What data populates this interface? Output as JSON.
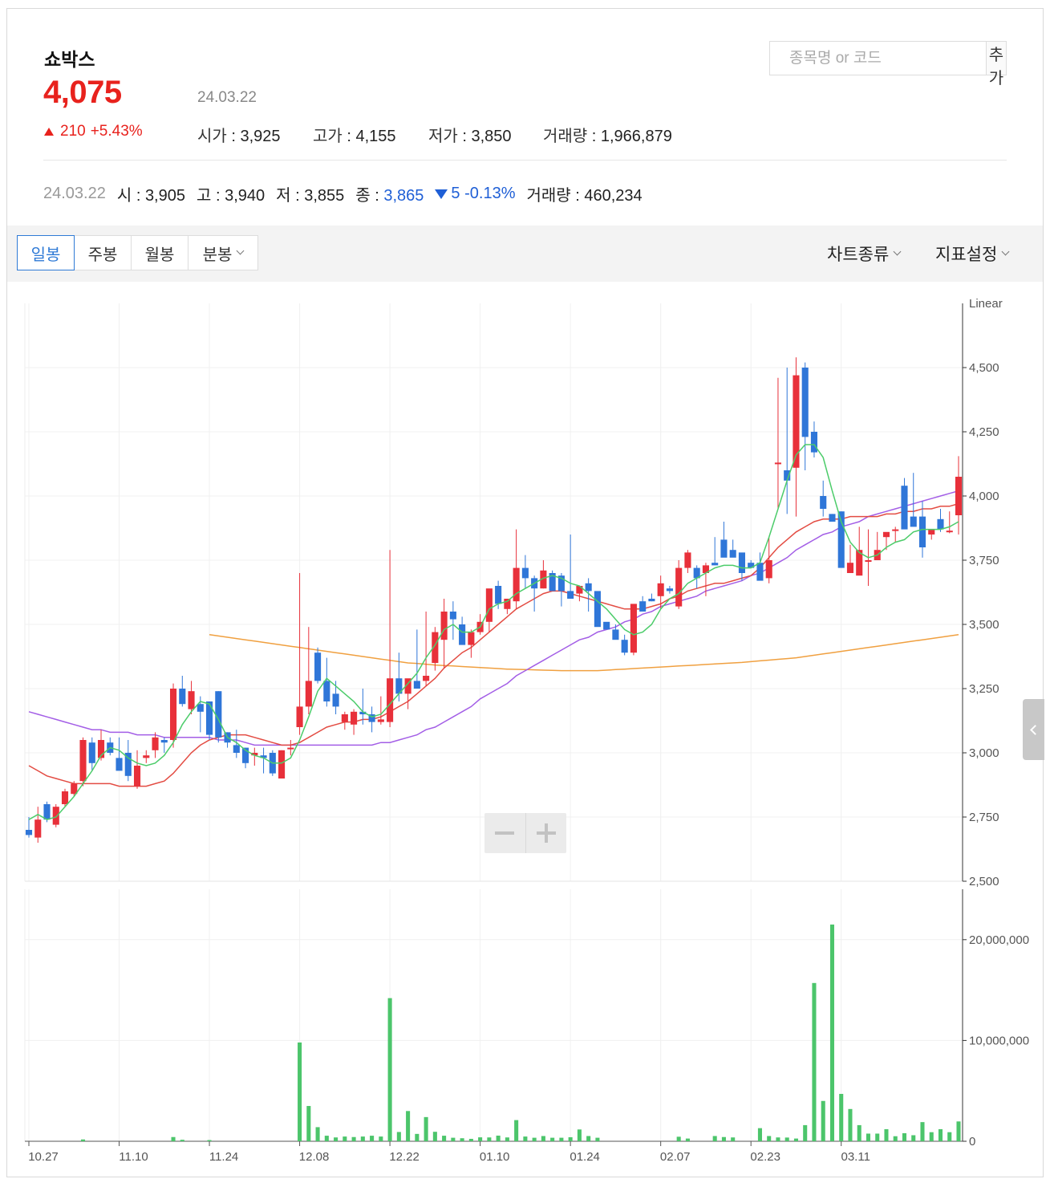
{
  "stock": {
    "name": "쇼박스",
    "price": "4,075",
    "date": "24.03.22",
    "change": "210",
    "change_pct": "+5.43%",
    "open_label": "시가",
    "open": "3,925",
    "high_label": "고가",
    "high": "4,155",
    "low_label": "저가",
    "low": "3,850",
    "volume_label": "거래량",
    "volume": "1,966,879"
  },
  "search": {
    "placeholder": "종목명 or 코드",
    "button": "추가"
  },
  "crosshair": {
    "date": "24.03.22",
    "open_label": "시",
    "open": "3,905",
    "high_label": "고",
    "high": "3,940",
    "low_label": "저",
    "low": "3,855",
    "close_label": "종",
    "close": "3,865",
    "change": "5",
    "change_pct": "-0.13%",
    "volume_label": "거래량",
    "volume": "460,234"
  },
  "tabs": [
    {
      "label": "일봉",
      "active": true
    },
    {
      "label": "주봉",
      "active": false
    },
    {
      "label": "월봉",
      "active": false
    },
    {
      "label": "분봉",
      "active": false
    }
  ],
  "toolbar": {
    "chart_type": "차트종류",
    "indicator": "지표설정"
  },
  "colors": {
    "up": "#e8303a",
    "down": "#2f76d8",
    "ma5": "#4ccc6a",
    "ma20": "#e34c43",
    "ma60": "#a35ee6",
    "ma120": "#f0a040",
    "volume": "#4cc56b"
  },
  "chart_data": [
    {
      "type": "candlestick",
      "scale_label": "Linear",
      "ylim": [
        2500,
        4750
      ],
      "y_ticks": [
        "2,500",
        "2,750",
        "3,000",
        "3,250",
        "3,500",
        "3,750",
        "4,000",
        "4,250",
        "4,500"
      ],
      "x_ticks": [
        {
          "label": "10.27",
          "index": 0
        },
        {
          "label": "11.10",
          "index": 10
        },
        {
          "label": "11.24",
          "index": 20
        },
        {
          "label": "12.08",
          "index": 30
        },
        {
          "label": "12.22",
          "index": 40
        },
        {
          "label": "01.10",
          "index": 50
        },
        {
          "label": "01.24",
          "index": 60
        },
        {
          "label": "02.07",
          "index": 70
        },
        {
          "label": "02.23",
          "index": 80
        },
        {
          "label": "03.11",
          "index": 90
        }
      ],
      "ohlc": [
        [
          2700,
          2750,
          2670,
          2680
        ],
        [
          2670,
          2790,
          2650,
          2740
        ],
        [
          2800,
          2810,
          2730,
          2740
        ],
        [
          2720,
          2800,
          2710,
          2790
        ],
        [
          2800,
          2860,
          2790,
          2850
        ],
        [
          2840,
          2890,
          2830,
          2880
        ],
        [
          2890,
          3060,
          2870,
          3050
        ],
        [
          3040,
          3060,
          2930,
          2960
        ],
        [
          2980,
          3090,
          2970,
          3050
        ],
        [
          3040,
          3060,
          2990,
          3000
        ],
        [
          2980,
          3060,
          2950,
          2930
        ],
        [
          3000,
          3050,
          2890,
          2910
        ],
        [
          2870,
          3010,
          2860,
          2950
        ],
        [
          2980,
          3010,
          2960,
          2990
        ],
        [
          3010,
          3080,
          2980,
          3060
        ],
        [
          3050,
          3060,
          3000,
          3040
        ],
        [
          3050,
          3270,
          3020,
          3250
        ],
        [
          3250,
          3300,
          3180,
          3190
        ],
        [
          3170,
          3280,
          3150,
          3240
        ],
        [
          3190,
          3220,
          3080,
          3160
        ],
        [
          3200,
          3200,
          3050,
          3070
        ],
        [
          3240,
          3240,
          3040,
          3060
        ],
        [
          3080,
          3080,
          3020,
          3040
        ],
        [
          3030,
          3090,
          2980,
          3000
        ],
        [
          3020,
          3020,
          2940,
          2960
        ],
        [
          2990,
          3020,
          2950,
          3000
        ],
        [
          2990,
          3020,
          2920,
          2980
        ],
        [
          3000,
          3010,
          2910,
          2920
        ],
        [
          2900,
          3010,
          2900,
          3010
        ],
        [
          3020,
          3050,
          2990,
          3020
        ],
        [
          3100,
          3700,
          3070,
          3180
        ],
        [
          3180,
          3490,
          3150,
          3280
        ],
        [
          3390,
          3410,
          3270,
          3280
        ],
        [
          3280,
          3370,
          3180,
          3200
        ],
        [
          3230,
          3280,
          3150,
          3180
        ],
        [
          3120,
          3160,
          3090,
          3150
        ],
        [
          3110,
          3170,
          3070,
          3160
        ],
        [
          3160,
          3250,
          3110,
          3150
        ],
        [
          3150,
          3180,
          3080,
          3120
        ],
        [
          3120,
          3220,
          3110,
          3130
        ],
        [
          3120,
          3790,
          3100,
          3290
        ],
        [
          3290,
          3390,
          3200,
          3230
        ],
        [
          3230,
          3270,
          3170,
          3290
        ],
        [
          3280,
          3480,
          3280,
          3250
        ],
        [
          3280,
          3550,
          3260,
          3300
        ],
        [
          3350,
          3490,
          3320,
          3470
        ],
        [
          3440,
          3600,
          3330,
          3550
        ],
        [
          3550,
          3590,
          3440,
          3520
        ],
        [
          3500,
          3530,
          3450,
          3420
        ],
        [
          3420,
          3480,
          3370,
          3470
        ],
        [
          3470,
          3540,
          3460,
          3510
        ],
        [
          3510,
          3560,
          3470,
          3640
        ],
        [
          3650,
          3670,
          3560,
          3580
        ],
        [
          3560,
          3580,
          3540,
          3600
        ],
        [
          3590,
          3870,
          3560,
          3720
        ],
        [
          3720,
          3770,
          3640,
          3680
        ],
        [
          3680,
          3690,
          3550,
          3640
        ],
        [
          3640,
          3750,
          3640,
          3710
        ],
        [
          3700,
          3710,
          3640,
          3630
        ],
        [
          3690,
          3700,
          3570,
          3630
        ],
        [
          3630,
          3850,
          3620,
          3600
        ],
        [
          3620,
          3650,
          3590,
          3650
        ],
        [
          3660,
          3680,
          3550,
          3630
        ],
        [
          3630,
          3600,
          3520,
          3490
        ],
        [
          3510,
          3490,
          3500,
          3480
        ],
        [
          3480,
          3500,
          3470,
          3440
        ],
        [
          3440,
          3460,
          3380,
          3390
        ],
        [
          3390,
          3460,
          3380,
          3580
        ],
        [
          3590,
          3610,
          3580,
          3550
        ],
        [
          3600,
          3620,
          3590,
          3590
        ],
        [
          3610,
          3690,
          3560,
          3660
        ],
        [
          3640,
          3650,
          3620,
          3630
        ],
        [
          3570,
          3750,
          3560,
          3720
        ],
        [
          3720,
          3790,
          3700,
          3780
        ],
        [
          3720,
          3730,
          3640,
          3680
        ],
        [
          3700,
          3740,
          3610,
          3730
        ],
        [
          3740,
          3840,
          3730,
          3730
        ],
        [
          3830,
          3900,
          3830,
          3760
        ],
        [
          3790,
          3830,
          3780,
          3760
        ],
        [
          3780,
          3770,
          3670,
          3700
        ],
        [
          3740,
          3750,
          3720,
          3720
        ],
        [
          3740,
          3780,
          3720,
          3670
        ],
        [
          3680,
          3840,
          3660,
          3750
        ],
        [
          4130,
          4460,
          3950,
          4130
        ],
        [
          4100,
          4500,
          3930,
          4060
        ],
        [
          4110,
          4540,
          3920,
          4470
        ],
        [
          4500,
          4520,
          4100,
          4230
        ],
        [
          4250,
          4290,
          4150,
          4170
        ],
        [
          4000,
          4060,
          3920,
          3950
        ],
        [
          3930,
          3930,
          3920,
          3900
        ],
        [
          3940,
          3940,
          3730,
          3720
        ],
        [
          3700,
          3810,
          3700,
          3740
        ],
        [
          3690,
          3880,
          3730,
          3790
        ],
        [
          3750,
          3870,
          3650,
          3750
        ],
        [
          3750,
          3860,
          3790,
          3790
        ],
        [
          3840,
          3850,
          3790,
          3860
        ],
        [
          3870,
          3880,
          3820,
          3870
        ],
        [
          4040,
          4070,
          3890,
          3870
        ],
        [
          3920,
          4090,
          3890,
          3880
        ],
        [
          3920,
          3980,
          3760,
          3800
        ],
        [
          3850,
          3870,
          3830,
          3870
        ],
        [
          3910,
          3950,
          3860,
          3870
        ],
        [
          3865,
          3940,
          3855,
          3865
        ],
        [
          3925,
          4155,
          3850,
          4075
        ]
      ],
      "ma5": [
        2740,
        2760,
        2740,
        2750,
        2790,
        2830,
        2880,
        2930,
        2990,
        3020,
        3010,
        2980,
        2960,
        2950,
        2960,
        2990,
        3040,
        3110,
        3160,
        3200,
        3190,
        3130,
        3060,
        3040,
        3010,
        2990,
        2980,
        2960,
        2960,
        2980,
        3050,
        3140,
        3240,
        3290,
        3260,
        3230,
        3200,
        3160,
        3140,
        3150,
        3190,
        3230,
        3270,
        3310,
        3370,
        3420,
        3480,
        3500,
        3470,
        3470,
        3490,
        3560,
        3580,
        3590,
        3620,
        3640,
        3660,
        3680,
        3690,
        3680,
        3660,
        3650,
        3620,
        3590,
        3560,
        3520,
        3480,
        3460,
        3470,
        3500,
        3560,
        3600,
        3620,
        3660,
        3680,
        3700,
        3720,
        3730,
        3730,
        3720,
        3720,
        3740,
        3840,
        3950,
        4060,
        4160,
        4200,
        4200,
        4150,
        4020,
        3900,
        3820,
        3780,
        3760,
        3770,
        3800,
        3820,
        3830,
        3860,
        3870,
        3870,
        3870,
        3880,
        3900
      ],
      "ma20": [
        2950,
        2930,
        2910,
        2900,
        2890,
        2880,
        2880,
        2880,
        2880,
        2880,
        2870,
        2870,
        2870,
        2870,
        2880,
        2890,
        2920,
        2960,
        3000,
        3030,
        3050,
        3060,
        3070,
        3070,
        3070,
        3060,
        3050,
        3040,
        3030,
        3030,
        3040,
        3060,
        3080,
        3100,
        3110,
        3120,
        3120,
        3130,
        3130,
        3140,
        3160,
        3180,
        3200,
        3230,
        3260,
        3290,
        3330,
        3360,
        3390,
        3410,
        3440,
        3470,
        3500,
        3530,
        3560,
        3580,
        3600,
        3620,
        3630,
        3630,
        3620,
        3610,
        3600,
        3590,
        3580,
        3570,
        3560,
        3560,
        3560,
        3570,
        3580,
        3600,
        3610,
        3630,
        3640,
        3650,
        3660,
        3660,
        3670,
        3680,
        3690,
        3720,
        3760,
        3800,
        3830,
        3860,
        3880,
        3900,
        3910,
        3910,
        3910,
        3920,
        3920,
        3920,
        3920,
        3930,
        3930,
        3940,
        3940,
        3950,
        3950,
        3960,
        3960,
        3970
      ],
      "ma60": [
        3160,
        3150,
        3140,
        3130,
        3120,
        3110,
        3100,
        3090,
        3090,
        3080,
        3080,
        3080,
        3070,
        3070,
        3070,
        3060,
        3060,
        3060,
        3060,
        3060,
        3060,
        3050,
        3050,
        3050,
        3040,
        3030,
        3030,
        3030,
        3030,
        3030,
        3030,
        3030,
        3030,
        3030,
        3030,
        3030,
        3030,
        3030,
        3030,
        3040,
        3040,
        3050,
        3060,
        3070,
        3090,
        3100,
        3120,
        3140,
        3160,
        3180,
        3210,
        3230,
        3250,
        3270,
        3300,
        3320,
        3340,
        3360,
        3380,
        3400,
        3420,
        3440,
        3450,
        3470,
        3480,
        3490,
        3510,
        3520,
        3540,
        3550,
        3570,
        3580,
        3590,
        3600,
        3610,
        3630,
        3640,
        3650,
        3660,
        3670,
        3690,
        3700,
        3720,
        3740,
        3760,
        3790,
        3810,
        3830,
        3850,
        3860,
        3880,
        3890,
        3900,
        3920,
        3930,
        3940,
        3950,
        3960,
        3970,
        3980,
        3990,
        4000,
        4010,
        4020
      ],
      "ma120": [
        null,
        null,
        null,
        null,
        null,
        null,
        null,
        null,
        null,
        null,
        null,
        null,
        null,
        null,
        null,
        null,
        null,
        null,
        null,
        null,
        3460,
        3455,
        3450,
        3445,
        3440,
        3435,
        3430,
        3425,
        3420,
        3415,
        3410,
        3405,
        3400,
        3395,
        3390,
        3385,
        3380,
        3375,
        3370,
        3365,
        3360,
        3355,
        3350,
        3348,
        3345,
        3342,
        3340,
        3338,
        3336,
        3334,
        3332,
        3330,
        3328,
        3326,
        3325,
        3324,
        3323,
        3322,
        3321,
        3320,
        3320,
        3320,
        3320,
        3320,
        3322,
        3324,
        3326,
        3328,
        3330,
        3332,
        3334,
        3336,
        3338,
        3340,
        3342,
        3344,
        3346,
        3348,
        3350,
        3352,
        3355,
        3358,
        3361,
        3364,
        3367,
        3370,
        3375,
        3380,
        3385,
        3390,
        3395,
        3400,
        3405,
        3410,
        3415,
        3420,
        3425,
        3430,
        3435,
        3440,
        3445,
        3450,
        3455,
        3460
      ]
    },
    {
      "type": "bar",
      "series_label": "volume",
      "ylim": [
        0,
        25000000
      ],
      "y_ticks": [
        "0",
        "10,000,000",
        "20,000,000"
      ],
      "values": [
        0,
        0,
        0,
        0,
        0,
        0,
        180000,
        0,
        0,
        0,
        0,
        0,
        0,
        0,
        0,
        0,
        420000,
        150000,
        0,
        0,
        120000,
        0,
        0,
        0,
        0,
        0,
        0,
        0,
        0,
        0,
        9800000,
        3500000,
        1400000,
        550000,
        380000,
        470000,
        420000,
        470000,
        550000,
        470000,
        14200000,
        920000,
        3000000,
        730000,
        2400000,
        940000,
        550000,
        350000,
        300000,
        240000,
        390000,
        380000,
        560000,
        380000,
        2100000,
        470000,
        350000,
        520000,
        350000,
        350000,
        400000,
        1170000,
        520000,
        350000,
        0,
        0,
        0,
        0,
        0,
        0,
        0,
        0,
        450000,
        270000,
        0,
        0,
        520000,
        420000,
        380000,
        0,
        0,
        1300000,
        520000,
        380000,
        370000,
        270000,
        1600000,
        15700000,
        4000000,
        21500000,
        4700000,
        3200000,
        1600000,
        760000,
        760000,
        1200000,
        500000,
        800000,
        600000,
        1900000,
        900000,
        1200000,
        900000,
        1966879
      ]
    }
  ]
}
